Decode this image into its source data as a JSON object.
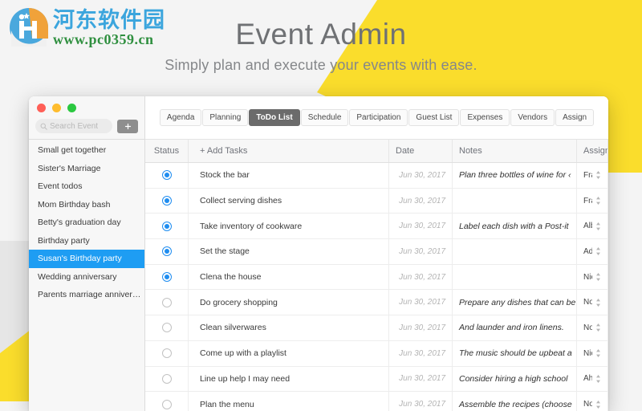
{
  "watermark": {
    "cn_text": "河东软件园",
    "url_text": "www.pc0359.cn",
    "brand_blue": "#3ba5dd",
    "brand_green": "#2f8f3f"
  },
  "hero": {
    "title": "Event Admin",
    "subtitle": "Simply plan and execute your events with ease.",
    "accent_yellow": "#fadd2c"
  },
  "window": {
    "traffic_lights": [
      "close",
      "minimize",
      "zoom"
    ]
  },
  "sidebar": {
    "search": {
      "placeholder": "Search Event",
      "value": ""
    },
    "add_button_label": "+",
    "items": [
      {
        "label": "Small get together",
        "selected": false
      },
      {
        "label": "Sister's Marriage",
        "selected": false
      },
      {
        "label": "Event todos",
        "selected": false
      },
      {
        "label": "Mom Birthday bash",
        "selected": false
      },
      {
        "label": "Betty's graduation day",
        "selected": false
      },
      {
        "label": "Birthday party",
        "selected": false
      },
      {
        "label": "Susan's Birthday party",
        "selected": true
      },
      {
        "label": "Wedding anniversary",
        "selected": false
      },
      {
        "label": "Parents marriage anniver…",
        "selected": false
      }
    ],
    "selected_color": "#1e9df3"
  },
  "tabs": [
    {
      "label": "Agenda",
      "active": false
    },
    {
      "label": "Planning",
      "active": false
    },
    {
      "label": "ToDo List",
      "active": true
    },
    {
      "label": "Schedule",
      "active": false
    },
    {
      "label": "Participation",
      "active": false
    },
    {
      "label": "Guest List",
      "active": false
    },
    {
      "label": "Expenses",
      "active": false
    },
    {
      "label": "Vendors",
      "active": false
    },
    {
      "label": "Assign",
      "active": false
    }
  ],
  "table": {
    "columns": [
      "Status",
      "+ Add Tasks",
      "Date",
      "Notes",
      "Assigned"
    ],
    "rows": [
      {
        "done": true,
        "task": "Stock the bar",
        "date": "Jun 30, 2017",
        "notes": "Plan three bottles of wine for ‹",
        "assigned": "Franklyn Emard"
      },
      {
        "done": true,
        "task": "Collect serving dishes",
        "date": "Jun 30, 2017",
        "notes": "",
        "assigned": "Francine Vocelka"
      },
      {
        "done": true,
        "task": "Take inventory of cookware",
        "date": "Jun 30, 2017",
        "notes": "Label each dish with a Post-it",
        "assigned": "Albina Glick"
      },
      {
        "done": true,
        "task": "Set the stage",
        "date": "Jun 30, 2017",
        "notes": "",
        "assigned": "Adell Lipkin"
      },
      {
        "done": true,
        "task": "Clena the house",
        "date": "Jun 30, 2017",
        "notes": "",
        "assigned": "Nieves Gotter"
      },
      {
        "done": false,
        "task": "Do grocery shopping",
        "date": "Jun 30, 2017",
        "notes": "Prepare any dishes that can be",
        "assigned": "Not Assigend"
      },
      {
        "done": false,
        "task": "Clean silverwares",
        "date": "Jun 30, 2017",
        "notes": "And launder and iron linens.",
        "assigned": "Not Assigend"
      },
      {
        "done": false,
        "task": "Come up with a playlist",
        "date": "Jun 30, 2017",
        "notes": "The music should be upbeat a",
        "assigned": "Nicolette Brossart"
      },
      {
        "done": false,
        "task": "Line up help I may need",
        "date": "Jun 30, 2017",
        "notes": "Consider hiring a high school",
        "assigned": "Ahmed Angalich"
      },
      {
        "done": false,
        "task": "Plan the menu",
        "date": "Jun 30, 2017",
        "notes": "Assemble the recipes (choose",
        "assigned": "Not Assigend"
      }
    ]
  }
}
